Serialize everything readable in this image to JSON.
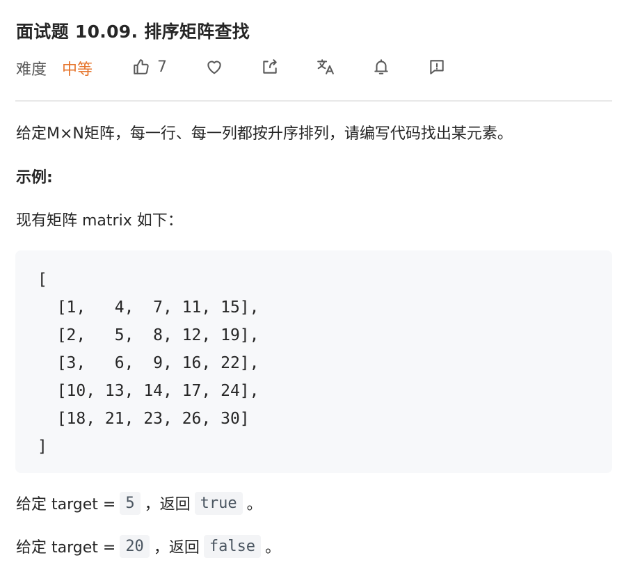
{
  "problem": {
    "title": "面试题 10.09. 排序矩阵查找",
    "difficulty_label": "难度",
    "difficulty": "中等",
    "likes": "7"
  },
  "toolbar": {
    "icons": [
      "thumbs-up-icon",
      "heart-icon",
      "share-icon",
      "translate-icon",
      "bell-icon",
      "comment-icon"
    ]
  },
  "content": {
    "description": "给定M×N矩阵，每一行、每一列都按升序排列，请编写代码找出某元素。",
    "example_heading": "示例:",
    "matrix_intro": "现有矩阵 matrix 如下：",
    "matrix_code": "[\n  [1,   4,  7, 11, 15],\n  [2,   5,  8, 12, 19],\n  [3,   6,  9, 16, 22],\n  [10, 13, 14, 17, 24],\n  [18, 21, 23, 26, 30]\n]",
    "example1": {
      "prefix": "给定 target = ",
      "target": "5",
      "middle": "，返回",
      "result": "true",
      "suffix": "。"
    },
    "example2": {
      "prefix": "给定 target = ",
      "target": "20",
      "middle": "，返回",
      "result": "false",
      "suffix": "。"
    }
  },
  "colors": {
    "difficulty": "#e6742b",
    "code_bg": "#f7f8fa"
  }
}
